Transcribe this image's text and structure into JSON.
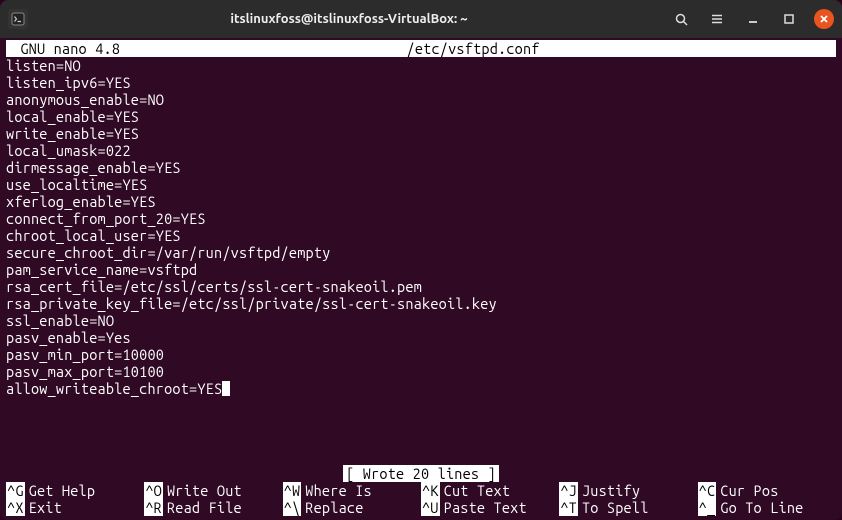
{
  "titlebar": {
    "title": "itslinuxfoss@itslinuxfoss-VirtualBox: ~"
  },
  "nano": {
    "header_left": " GNU nano 4.8",
    "header_file": "/etc/vsftpd.conf",
    "status": "[ Wrote 20 lines ]",
    "lines": [
      "listen=NO",
      "listen_ipv6=YES",
      "anonymous_enable=NO",
      "local_enable=YES",
      "write_enable=YES",
      "local_umask=022",
      "dirmessage_enable=YES",
      "use_localtime=YES",
      "xferlog_enable=YES",
      "connect_from_port_20=YES",
      "chroot_local_user=YES",
      "secure_chroot_dir=/var/run/vsftpd/empty",
      "pam_service_name=vsftpd",
      "rsa_cert_file=/etc/ssl/certs/ssl-cert-snakeoil.pem",
      "rsa_private_key_file=/etc/ssl/private/ssl-cert-snakeoil.key",
      "ssl_enable=NO",
      "pasv_enable=Yes",
      "pasv_min_port=10000",
      "pasv_max_port=10100",
      "allow_writeable_chroot=YES"
    ],
    "help_row1": [
      {
        "key": "^G",
        "label": "Get Help"
      },
      {
        "key": "^O",
        "label": "Write Out"
      },
      {
        "key": "^W",
        "label": "Where Is"
      },
      {
        "key": "^K",
        "label": "Cut Text"
      },
      {
        "key": "^J",
        "label": "Justify"
      },
      {
        "key": "^C",
        "label": "Cur Pos"
      }
    ],
    "help_row2": [
      {
        "key": "^X",
        "label": "Exit"
      },
      {
        "key": "^R",
        "label": "Read File"
      },
      {
        "key": "^\\",
        "label": "Replace"
      },
      {
        "key": "^U",
        "label": "Paste Text"
      },
      {
        "key": "^T",
        "label": "To Spell"
      },
      {
        "key": "^_",
        "label": "Go To Line"
      }
    ]
  }
}
